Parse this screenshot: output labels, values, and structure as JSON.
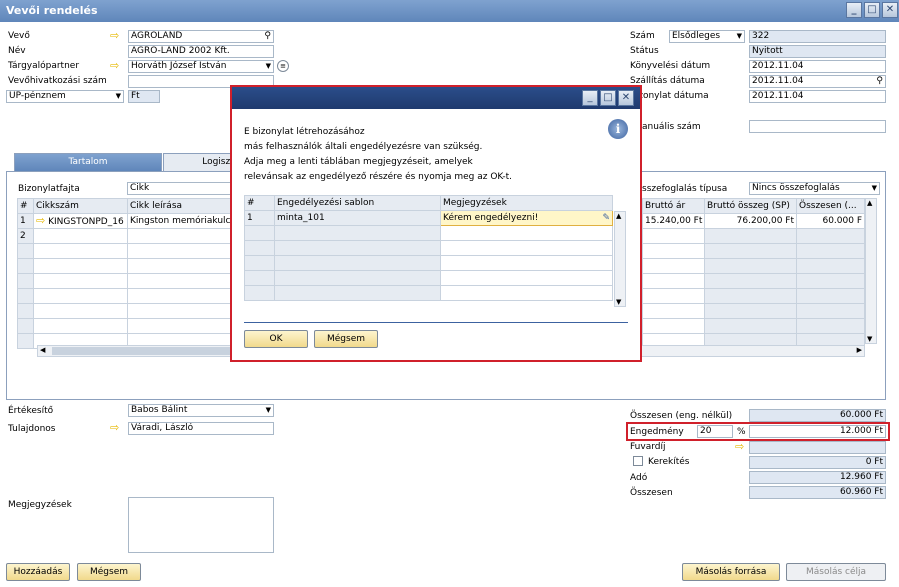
{
  "window": {
    "title": "Vevői rendelés"
  },
  "header": {
    "vevo_label": "Vevő",
    "vevo_value": "AGROLAND",
    "nev_label": "Név",
    "nev_value": "AGRO-LAND 2002 Kft.",
    "targyalo_label": "Tárgyalópartner",
    "targyalo_value": "Horváth József István",
    "hivatkozas_label": "Vevőhivatkozási szám",
    "hivatkozas_value": "",
    "penznem_value": "ÜP-pénznem",
    "penznem_currency": "Ft",
    "szam_label": "Szám",
    "szam_series": "Elsődleges",
    "szam_value": "322",
    "status_label": "Státus",
    "status_value": "Nyitott",
    "konyvelesi_label": "Könyvelési dátum",
    "konyvelesi_value": "2012.11.04",
    "szallitas_label": "Szállítás dátuma",
    "szallitas_value": "2012.11.04",
    "bizonylat_label": "bizonylat dátuma",
    "bizonylat_value": "2012.11.04",
    "manualis_label": "anuális szám",
    "manualis_value": ""
  },
  "tabs": [
    {
      "label": "Tartalom"
    },
    {
      "label": "Logiszt"
    }
  ],
  "content": {
    "bizonylatfajta_label": "Bizonylatfajta",
    "bizonylatfajta_value": "Cikk",
    "osszefoglalas_label": "sszefoglalás típusa",
    "osszefoglalas_value": "Nincs összefoglalás",
    "columns": [
      "#",
      "Cikkszám",
      "Cikk leírása"
    ],
    "columns_right": [
      "Bruttó ár",
      "Bruttó összeg (SP)",
      "Összesen (..."
    ],
    "rows": [
      {
        "num": "1",
        "cikkszam": "KINGSTONPD_16",
        "leiras": "Kingston memóriakulcs",
        "brutto_ar": "15.240,00 Ft",
        "brutto_osszeg": "76.200,00 Ft",
        "osszesen": "60.000 F"
      },
      {
        "num": "2",
        "cikkszam": "",
        "leiras": "",
        "brutto_ar": "",
        "brutto_osszeg": "",
        "osszesen": ""
      }
    ]
  },
  "footer": {
    "ertekesito_label": "Értékesítő",
    "ertekesito_value": "Babos Bálint",
    "tulajdonos_label": "Tulajdonos",
    "tulajdonos_value": "Váradi, László",
    "megjegyzesek_label": "Megjegyzések",
    "osszesen_eng_label": "Összesen (eng. nélkül)",
    "osszesen_eng_value": "60.000 Ft",
    "engedmeny_label": "Engedmény",
    "engedmeny_pct": "20",
    "pct_sign": "%",
    "engedmeny_value": "12.000 Ft",
    "fuvardij_label": "Fuvardíj",
    "kerekites_label": "Kerekítés",
    "kerekites_value": "0 Ft",
    "ado_label": "Adó",
    "ado_value": "12.960 Ft",
    "osszesen_label": "Összesen",
    "osszesen_value": "60.960 Ft"
  },
  "buttons": {
    "hozzaadas": "Hozzáadás",
    "megsem": "Mégsem",
    "masolas_forrasa": "Másolás forrása",
    "masolas_celja": "Másolás célja"
  },
  "dialog": {
    "message": [
      "E bizonylat létrehozásához",
      "más felhasználók általi engedélyezésre van szükség.",
      "Adja meg a lenti táblában megjegyzéseit, amelyek",
      "relevánsak az engedélyező részére és nyomja meg az OK-t."
    ],
    "columns": [
      "#",
      "Engedélyezési sablon",
      "Megjegyzések"
    ],
    "rows": [
      {
        "num": "1",
        "sablon": "minta_101",
        "megjegyzes": "Kérem engedélyezni!"
      }
    ],
    "ok": "OK",
    "cancel": "Mégsem"
  },
  "colors": {
    "accent_red": "#d0202b",
    "title_blue": "#5f86ba",
    "dialog_blue": "#1f3a6e"
  }
}
